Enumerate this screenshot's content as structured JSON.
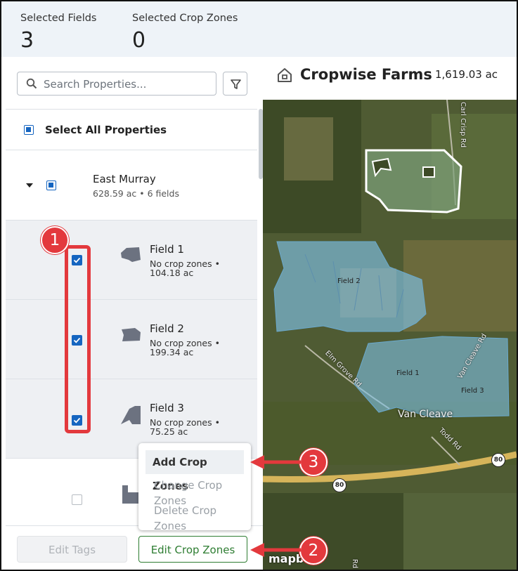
{
  "stats": {
    "selected_fields_label": "Selected Fields",
    "selected_fields_value": "3",
    "selected_crop_zones_label": "Selected Crop Zones",
    "selected_crop_zones_value": "0"
  },
  "search": {
    "placeholder": "Search Properties..."
  },
  "select_all_label": "Select All Properties",
  "farm": {
    "name": "East Murray",
    "meta": "628.59 ac • 6 fields"
  },
  "fields": [
    {
      "name": "Field 1",
      "zones": "No crop zones •",
      "acres": "104.18 ac",
      "checked": true
    },
    {
      "name": "Field 2",
      "zones": "No crop zones •",
      "acres": "199.34 ac",
      "checked": true
    },
    {
      "name": "Field 3",
      "zones": "No crop zones •",
      "acres": "75.25 ac",
      "checked": true
    },
    {
      "name": "",
      "zones": "",
      "acres": "",
      "checked": false
    }
  ],
  "org": {
    "name": "Cropwise Farms",
    "acres": "1,619.03 ac"
  },
  "buttons": {
    "edit_tags": "Edit Tags",
    "edit_crop_zones": "Edit Crop Zones"
  },
  "menu": {
    "add": "Add Crop Zones",
    "change": "Change Crop Zones",
    "delete": "Delete Crop Zones"
  },
  "callouts": {
    "c1": "1",
    "c2": "2",
    "c3": "3"
  },
  "map": {
    "labels": {
      "field1": "Field 1",
      "field2": "Field 2",
      "field3": "Field 3",
      "town": "Van Cleave",
      "road_carl": "Carl Crisp Rd",
      "road_elm": "Elm Grove Rd",
      "road_vancleave": "Van Cleave Rd",
      "road_todd": "Todd Rd",
      "hwy1": "80",
      "hwy2": "80",
      "attribution": "mapbox",
      "road_r": "Rd"
    }
  },
  "colors": {
    "accent": "#1565c0",
    "callout": "#e3393d",
    "button_green": "#2e7d32"
  }
}
